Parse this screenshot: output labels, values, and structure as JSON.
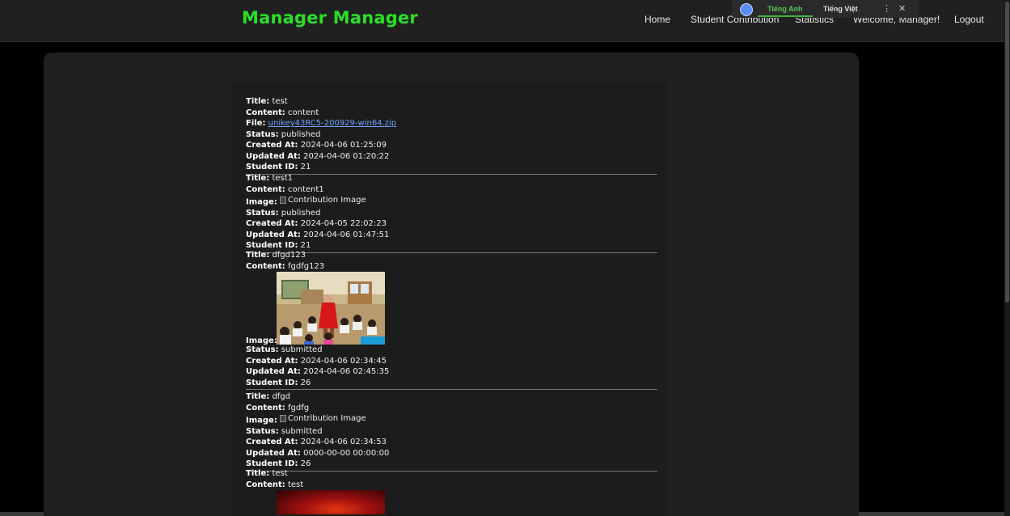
{
  "nav": {
    "brand": "Manager Manager",
    "home": "Home",
    "student_contribution": "Student Contribution",
    "statistics": "Statistics",
    "welcome": "Welcome, Manager!",
    "logout": "Logout"
  },
  "translate": {
    "tab_english": "Tiếng Anh",
    "tab_vietnamese": "Tiếng Việt",
    "more": "⋮",
    "close": "✕",
    "colors": {
      "active": "#3cb33c"
    }
  },
  "labels": {
    "title": "Title:",
    "content": "Content:",
    "file": "File:",
    "image": "Image:",
    "status": "Status:",
    "created_at": "Created At:",
    "updated_at": "Updated At:",
    "student_id": "Student ID:"
  },
  "contributions": [
    {
      "title": "test",
      "content": "content",
      "file": "unikey43RC5-200929-win64.zip",
      "status": "published",
      "created_at": "2024-04-06 01:25:09",
      "updated_at": "2024-04-06 01:20:22",
      "student_id": "21"
    },
    {
      "title": "test1",
      "content": "content1",
      "image_alt": "Contribution Image",
      "status": "published",
      "created_at": "2024-04-05 22:02:23",
      "updated_at": "2024-04-06 01:47:51",
      "student_id": "21"
    },
    {
      "title": "dfgd123",
      "content": "fgdfg123",
      "status": "submitted",
      "created_at": "2024-04-06 02:34:45",
      "updated_at": "2024-04-06 02:45:35",
      "student_id": "26"
    },
    {
      "title": "dfgd",
      "content": "fgdfg",
      "image_alt": "Contribution Image",
      "status": "submitted",
      "created_at": "2024-04-06 02:34:53",
      "updated_at": "0000-00-00 00:00:00",
      "student_id": "26"
    },
    {
      "title": "test",
      "content": "test"
    }
  ],
  "colors": {
    "brand": "#28e028",
    "background": "#000000",
    "panel": "#1f1f1f",
    "link": "#6fa0ff"
  }
}
